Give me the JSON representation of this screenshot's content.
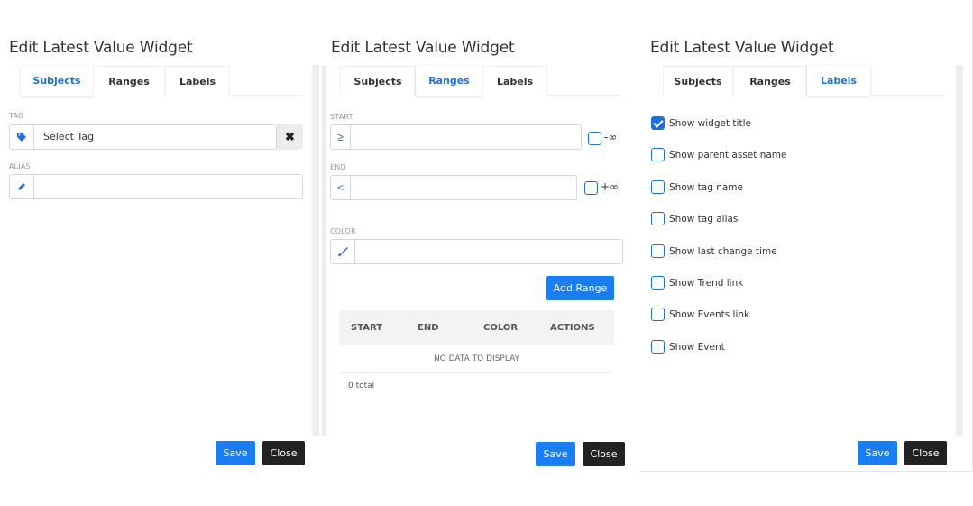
{
  "panel1": {
    "title": "Edit Latest Value Widget",
    "tabs": [
      "Subjects",
      "Ranges",
      "Labels"
    ],
    "tag_label": "TAG",
    "tag_value": "Select Tag",
    "alias_label": "ALIAS",
    "alias_value": "",
    "save_label": "Save",
    "close_label": "Close"
  },
  "panel2": {
    "title": "Edit Latest Value Widget",
    "tabs": [
      "Subjects",
      "Ranges",
      "Labels"
    ],
    "start_label": "START",
    "start_op": "≥",
    "start_value": "",
    "neg_inf": "-∞",
    "end_label": "END",
    "end_op": "<",
    "end_value": "",
    "pos_inf": "+∞",
    "color_label": "COLOR",
    "color_value": "",
    "add_range_label": "Add Range",
    "table_headers": [
      "START",
      "END",
      "COLOR",
      "ACTIONS"
    ],
    "no_data": "NO DATA TO DISPLAY",
    "total": "0 total",
    "save_label": "Save",
    "close_label": "Close"
  },
  "panel3": {
    "title": "Edit Latest Value Widget",
    "tabs": [
      "Subjects",
      "Ranges",
      "Labels"
    ],
    "options": [
      {
        "label": "Show widget title",
        "checked": true
      },
      {
        "label": "Show parent asset name",
        "checked": false
      },
      {
        "label": "Show tag name",
        "checked": false
      },
      {
        "label": "Show tag alias",
        "checked": false
      },
      {
        "label": "Show last change time",
        "checked": false
      },
      {
        "label": "Show Trend link",
        "checked": false
      },
      {
        "label": "Show Events link",
        "checked": false
      },
      {
        "label": "Show Event",
        "checked": false
      }
    ],
    "save_label": "Save",
    "close_label": "Close"
  },
  "colors": {
    "accent": "#1e6fd9",
    "primary_button": "#1a7ef2",
    "dark_button": "#222222"
  }
}
